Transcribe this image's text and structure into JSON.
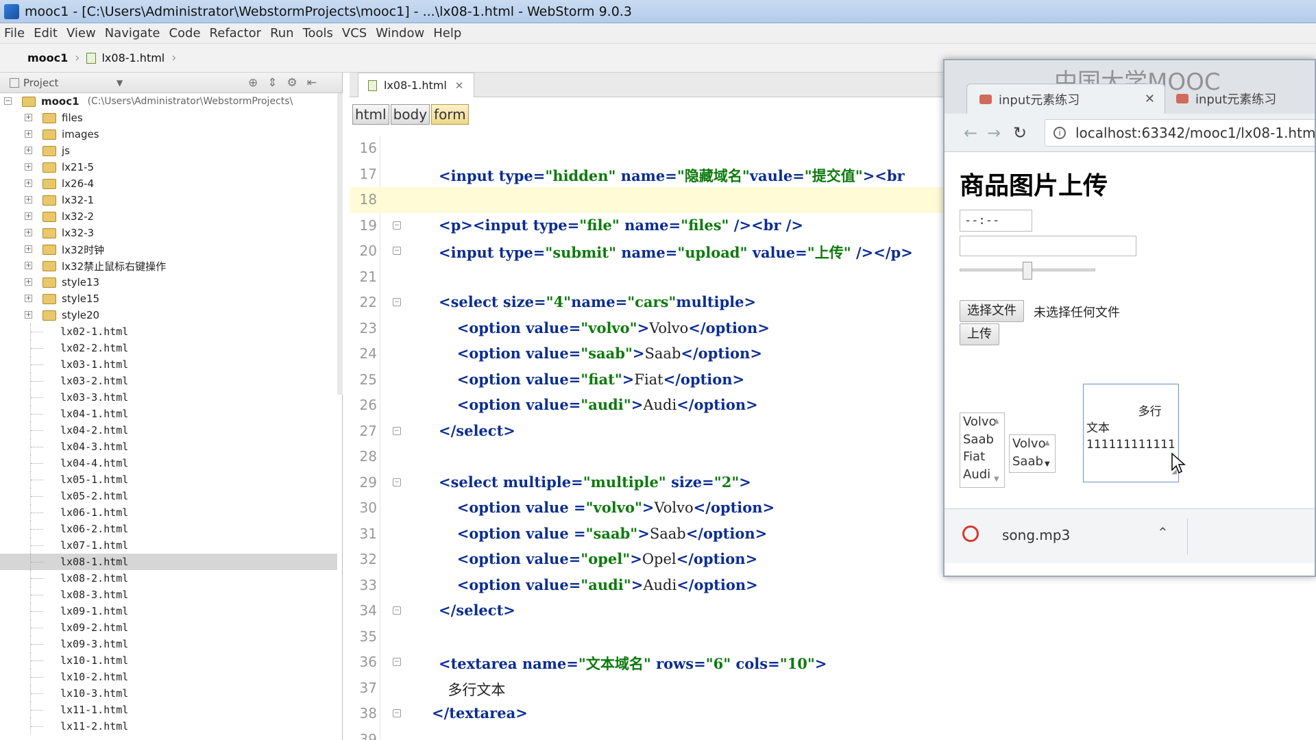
{
  "window": {
    "title": "mooc1 - [C:\\Users\\Administrator\\WebstormProjects\\mooc1] - ...\\lx08-1.html - WebStorm 9.0.3"
  },
  "menu": [
    "File",
    "Edit",
    "View",
    "Navigate",
    "Code",
    "Refactor",
    "Run",
    "Tools",
    "VCS",
    "Window",
    "Help"
  ],
  "navbar": {
    "project": "mooc1",
    "file": "lx08-1.html"
  },
  "project_panel": {
    "label": "Project",
    "root": {
      "name": "mooc1",
      "path": "(C:\\Users\\Administrator\\WebstormProjects\\"
    },
    "folders": [
      "files",
      "images",
      "js",
      "lx21-5",
      "lx26-4",
      "lx32-1",
      "lx32-2",
      "lx32-3",
      "lx32时钟",
      "lx32禁止鼠标右键操作",
      "style13",
      "style15",
      "style20"
    ],
    "files": [
      "lx02-1.html",
      "lx02-2.html",
      "lx03-1.html",
      "lx03-2.html",
      "lx03-3.html",
      "lx04-1.html",
      "lx04-2.html",
      "lx04-3.html",
      "lx04-4.html",
      "lx05-1.html",
      "lx05-2.html",
      "lx06-1.html",
      "lx06-2.html",
      "lx07-1.html",
      "lx08-1.html",
      "lx08-2.html",
      "lx08-3.html",
      "lx09-1.html",
      "lx09-2.html",
      "lx09-3.html",
      "lx10-1.html",
      "lx10-2.html",
      "lx10-3.html",
      "lx11-1.html",
      "lx11-2.html"
    ],
    "selected_file": "lx08-1.html"
  },
  "editor": {
    "tab": "lx08-1.html",
    "breadcrumbs": [
      "html",
      "body",
      "form"
    ],
    "lines": [
      {
        "num": "16",
        "text": ""
      },
      {
        "num": "17",
        "text": "<input type=\"hidden\" name=\"隐藏域名\"vaule=\"提交值\"><br"
      },
      {
        "num": "18",
        "text": ""
      },
      {
        "num": "19",
        "text": "<p><input type=\"file\" name=\"files\" /><br />"
      },
      {
        "num": "20",
        "text": "<input type=\"submit\" name=\"upload\" value=\"上传\" /></p>"
      },
      {
        "num": "21",
        "text": ""
      },
      {
        "num": "22",
        "text": "<select size=\"4\"name=\"cars\"multiple>"
      },
      {
        "num": "23",
        "text": "    <option value=\"volvo\">Volvo</option>"
      },
      {
        "num": "24",
        "text": "    <option value=\"saab\">Saab</option>"
      },
      {
        "num": "25",
        "text": "    <option value=\"fiat\">Fiat</option>"
      },
      {
        "num": "26",
        "text": "    <option value=\"audi\">Audi</option>"
      },
      {
        "num": "27",
        "text": "</select>"
      },
      {
        "num": "28",
        "text": ""
      },
      {
        "num": "29",
        "text": "<select multiple=\"multiple\" size=\"2\">"
      },
      {
        "num": "30",
        "text": "    <option value =\"volvo\">Volvo</option>"
      },
      {
        "num": "31",
        "text": "    <option value =\"saab\">Saab</option>"
      },
      {
        "num": "32",
        "text": "    <option value=\"opel\">Opel</option>"
      },
      {
        "num": "33",
        "text": "    <option value=\"audi\">Audi</option>"
      },
      {
        "num": "34",
        "text": "</select>"
      },
      {
        "num": "35",
        "text": ""
      },
      {
        "num": "36",
        "text": "<textarea name=\"文本域名\" rows=\"6\" cols=\"10\">"
      },
      {
        "num": "37",
        "text": "  多行文本"
      },
      {
        "num": "38",
        "text": "</textarea>"
      },
      {
        "num": "39",
        "text": ""
      }
    ]
  },
  "browser": {
    "watermark": "中国大学MOOC",
    "tabs": [
      "input元素练习",
      "input元素练习"
    ],
    "url": "localhost:63342/mooc1/lx08-1.htm",
    "page": {
      "heading": "商品图片上传",
      "time_value": "--:--",
      "range_value": 0.5,
      "file_button": "选择文件",
      "file_status": "未选择任何文件",
      "upload_button": "上传",
      "listbox1": [
        "Volvo",
        "Saab",
        "Fiat",
        "Audi"
      ],
      "listbox2": [
        "Volvo",
        "Saab"
      ],
      "textarea_value": "        多行\n文本\n111111111111"
    },
    "download": {
      "filename": "song.mp3"
    }
  }
}
